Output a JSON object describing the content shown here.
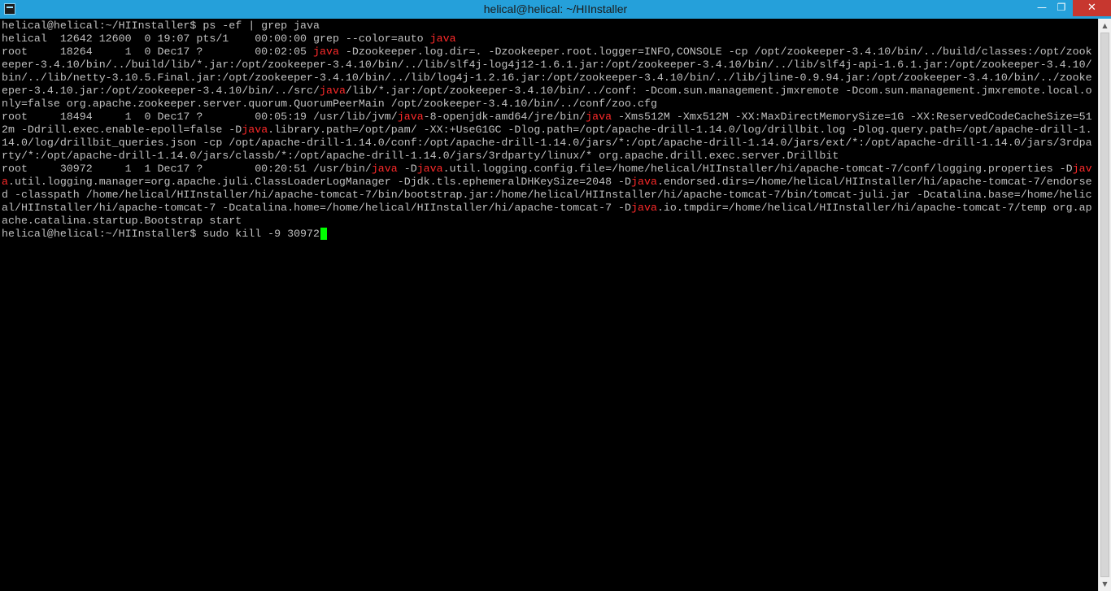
{
  "window": {
    "title": "helical@helical: ~/HIInstaller",
    "icon": "terminal-icon",
    "minimize_symbol": "—",
    "maximize_symbol": "❐",
    "close_symbol": "✕"
  },
  "colors": {
    "titlebar": "#25a0da",
    "close_button": "#c7372f",
    "background": "#000000",
    "text": "#c0c0c0",
    "highlight": "#ff2a2a",
    "cursor": "#00ff00"
  },
  "terminal": {
    "lines": [
      [
        {
          "t": "helical@helical:~/HIInstaller$ ps -ef | grep java"
        }
      ],
      [
        {
          "t": "helical  12642 12600  0 19:07 pts/1    00:00:00 grep --color=auto "
        },
        {
          "t": "java",
          "hl": true
        }
      ],
      [
        {
          "t": "root     18264     1  0 Dec17 ?        00:02:05 "
        },
        {
          "t": "java",
          "hl": true
        },
        {
          "t": " -Dzookeeper.log.dir=. -Dzookeeper.root.logger=INFO,CONSOLE -cp /opt/zookeeper-3.4.10/bin/../build/classes:/opt/zook"
        }
      ],
      [
        {
          "t": "eeper-3.4.10/bin/../build/lib/*.jar:/opt/zookeeper-3.4.10/bin/../lib/slf4j-log4j12-1.6.1.jar:/opt/zookeeper-3.4.10/bin/../lib/slf4j-api-1.6.1.jar:/opt/zookeeper-3.4.10/"
        }
      ],
      [
        {
          "t": "bin/../lib/netty-3.10.5.Final.jar:/opt/zookeeper-3.4.10/bin/../lib/log4j-1.2.16.jar:/opt/zookeeper-3.4.10/bin/../lib/jline-0.9.94.jar:/opt/zookeeper-3.4.10/bin/../zooke"
        }
      ],
      [
        {
          "t": "eper-3.4.10.jar:/opt/zookeeper-3.4.10/bin/../src/"
        },
        {
          "t": "java",
          "hl": true
        },
        {
          "t": "/lib/*.jar:/opt/zookeeper-3.4.10/bin/../conf: -Dcom.sun.management.jmxremote -Dcom.sun.management.jmxremote.local.o"
        }
      ],
      [
        {
          "t": "nly=false org.apache.zookeeper.server.quorum.QuorumPeerMain /opt/zookeeper-3.4.10/bin/../conf/zoo.cfg"
        }
      ],
      [
        {
          "t": "root     18494     1  0 Dec17 ?        00:05:19 /usr/lib/jvm/"
        },
        {
          "t": "java",
          "hl": true
        },
        {
          "t": "-8-openjdk-amd64/jre/bin/"
        },
        {
          "t": "java",
          "hl": true
        },
        {
          "t": " -Xms512M -Xmx512M -XX:MaxDirectMemorySize=1G -XX:ReservedCodeCacheSize=51"
        }
      ],
      [
        {
          "t": "2m -Ddrill.exec.enable-epoll=false -D"
        },
        {
          "t": "java",
          "hl": true
        },
        {
          "t": ".library.path=/opt/pam/ -XX:+UseG1GC -Dlog.path=/opt/apache-drill-1.14.0/log/drillbit.log -Dlog.query.path=/opt/apache-drill-1."
        }
      ],
      [
        {
          "t": "14.0/log/drillbit_queries.json -cp /opt/apache-drill-1.14.0/conf:/opt/apache-drill-1.14.0/jars/*:/opt/apache-drill-1.14.0/jars/ext/*:/opt/apache-drill-1.14.0/jars/3rdpa"
        }
      ],
      [
        {
          "t": "rty/*:/opt/apache-drill-1.14.0/jars/classb/*:/opt/apache-drill-1.14.0/jars/3rdparty/linux/* org.apache.drill.exec.server.Drillbit"
        }
      ],
      [
        {
          "t": "root     30972     1  1 Dec17 ?        00:20:51 /usr/bin/"
        },
        {
          "t": "java",
          "hl": true
        },
        {
          "t": " -D"
        },
        {
          "t": "java",
          "hl": true
        },
        {
          "t": ".util.logging.config.file=/home/helical/HIInstaller/hi/apache-tomcat-7/conf/logging.properties -D"
        },
        {
          "t": "jav",
          "hl": true
        }
      ],
      [
        {
          "t": "a",
          "hl": true
        },
        {
          "t": ".util.logging.manager=org.apache.juli.ClassLoaderLogManager -Djdk.tls.ephemeralDHKeySize=2048 -D"
        },
        {
          "t": "java",
          "hl": true
        },
        {
          "t": ".endorsed.dirs=/home/helical/HIInstaller/hi/apache-tomcat-7/endorse"
        }
      ],
      [
        {
          "t": "d -classpath /home/helical/HIInstaller/hi/apache-tomcat-7/bin/bootstrap.jar:/home/helical/HIInstaller/hi/apache-tomcat-7/bin/tomcat-juli.jar -Dcatalina.base=/home/helic"
        }
      ],
      [
        {
          "t": "al/HIInstaller/hi/apache-tomcat-7 -Dcatalina.home=/home/helical/HIInstaller/hi/apache-tomcat-7 -D"
        },
        {
          "t": "java",
          "hl": true
        },
        {
          "t": ".io.tmpdir=/home/helical/HIInstaller/hi/apache-tomcat-7/temp org.ap"
        }
      ],
      [
        {
          "t": "ache.catalina.startup.Bootstrap start"
        }
      ],
      [
        {
          "t": "helical@helical:~/HIInstaller$ sudo kill -9 30972"
        }
      ]
    ]
  },
  "scrollbar": {
    "up_symbol": "▲",
    "down_symbol": "▼"
  }
}
